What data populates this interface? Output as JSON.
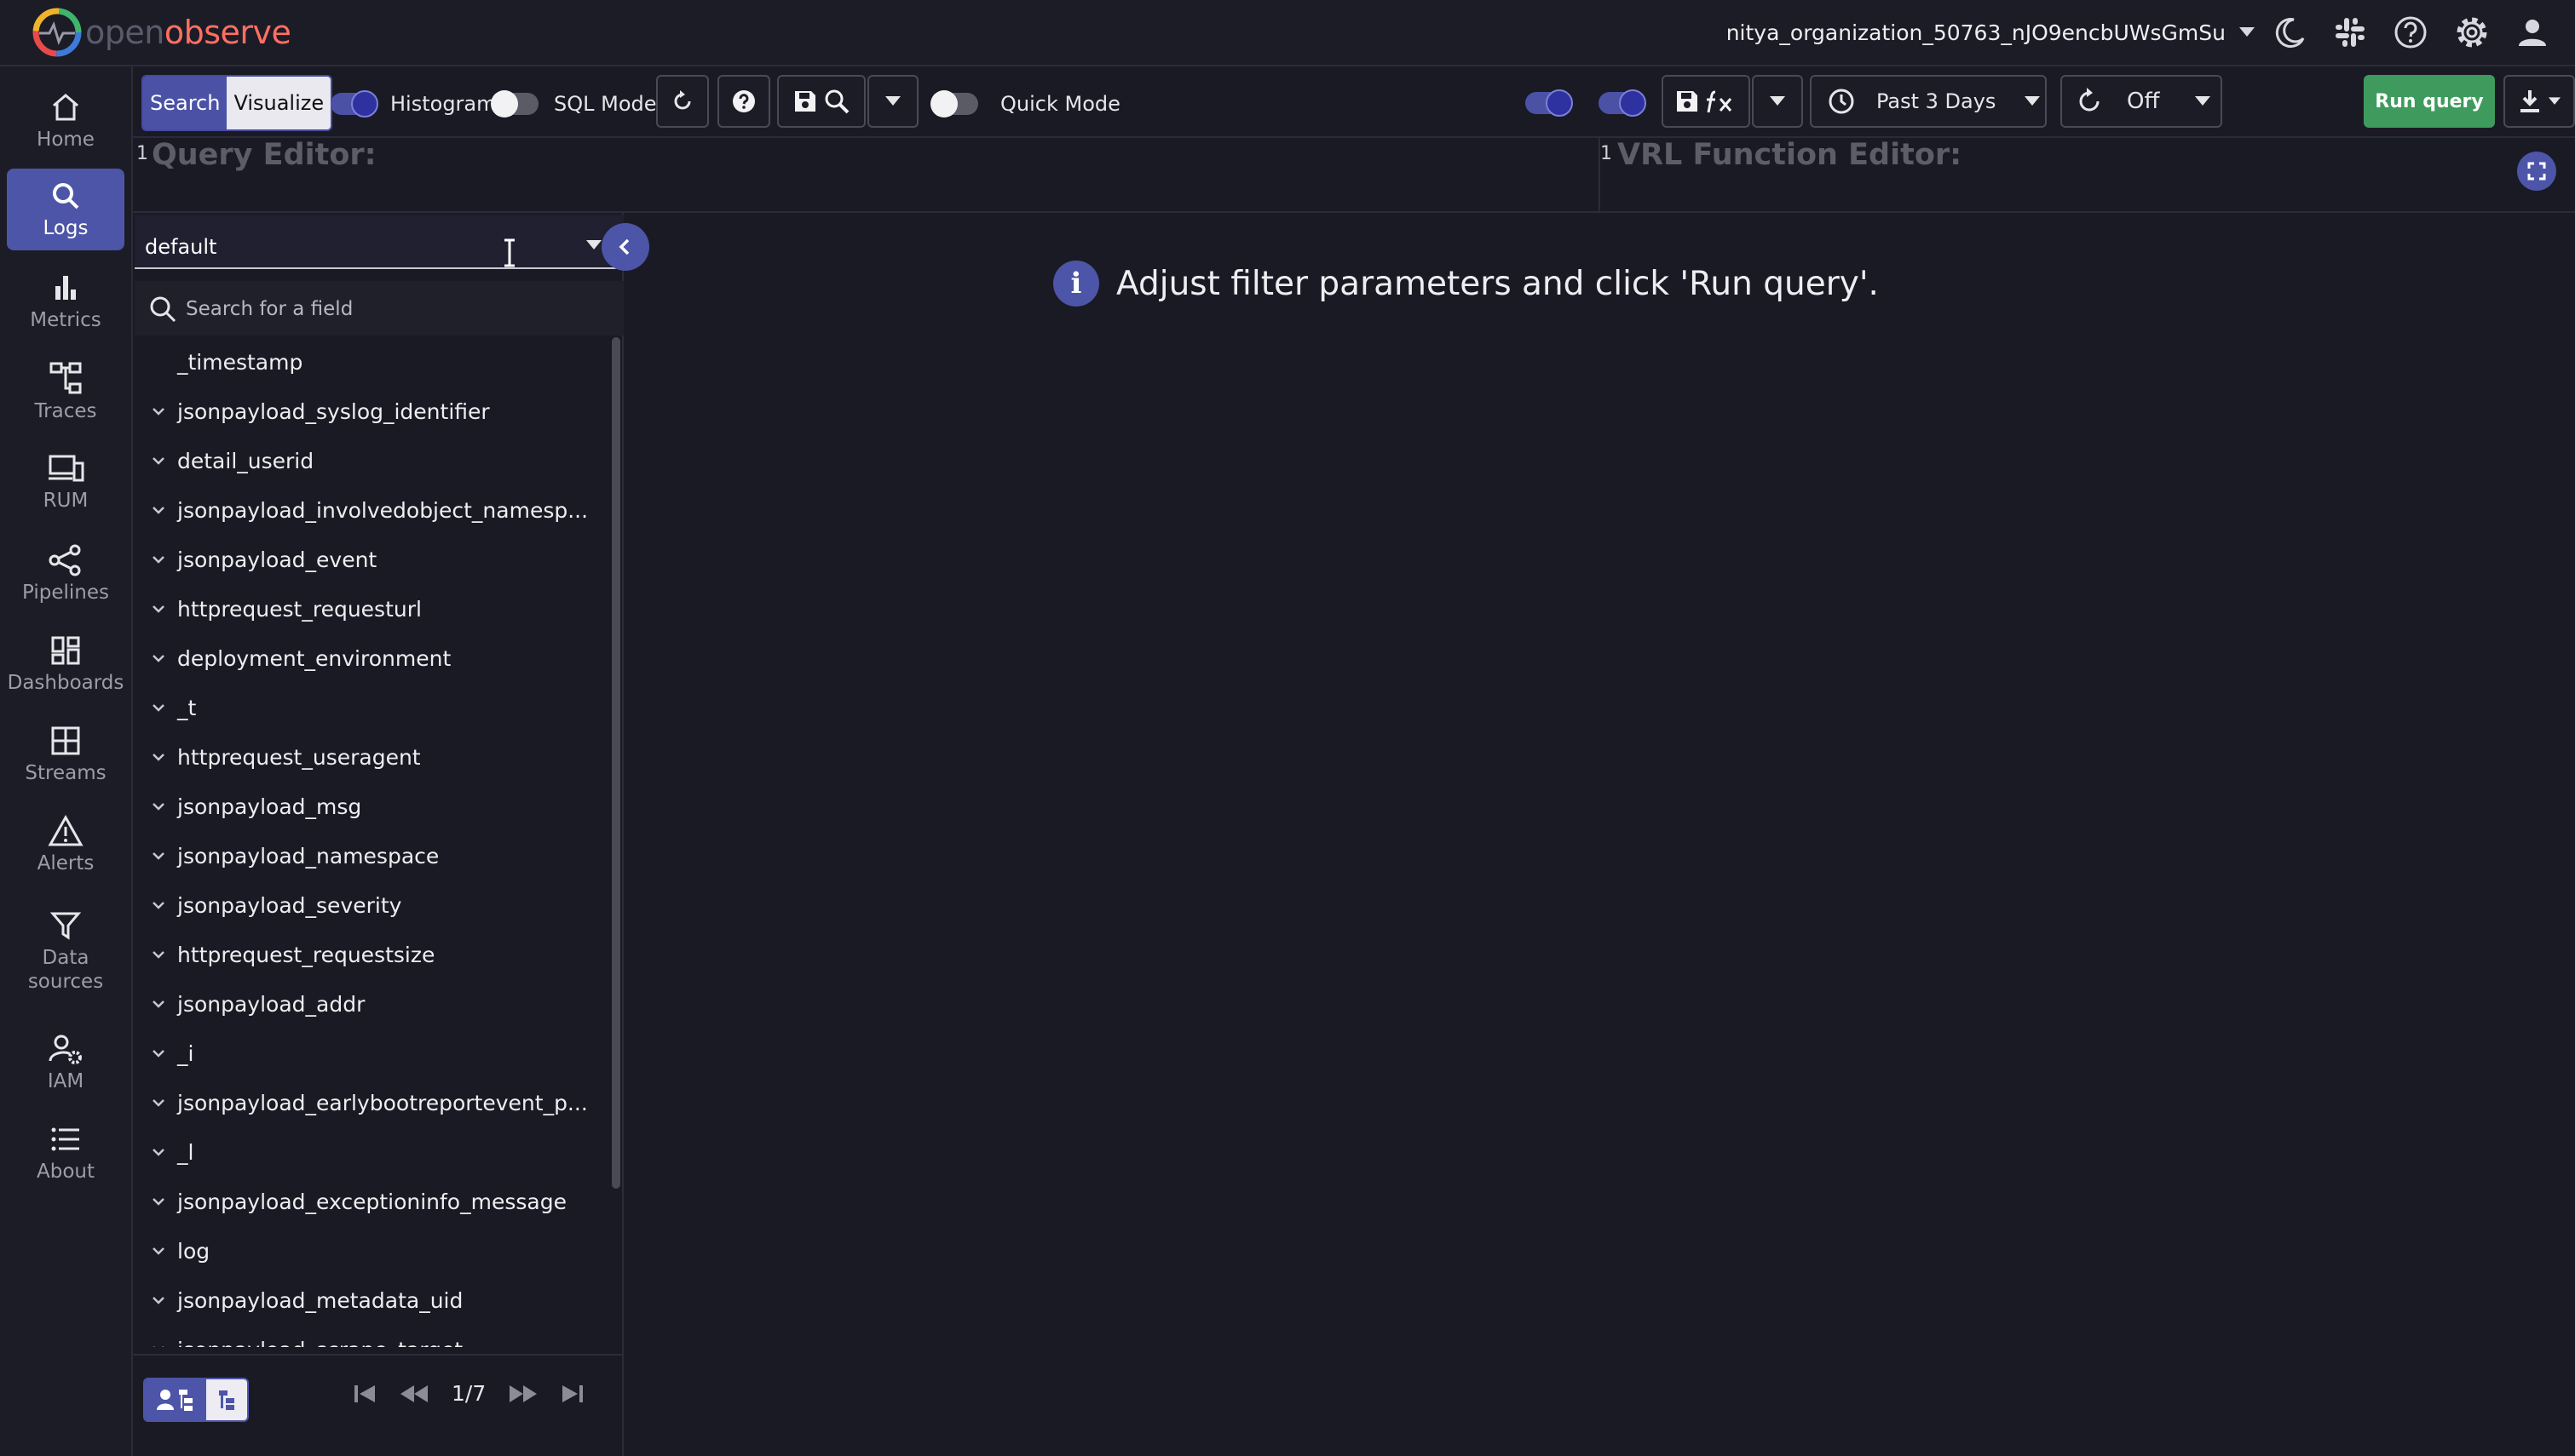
{
  "app": {
    "logo_part1": "open",
    "logo_part2": "observe"
  },
  "header": {
    "organization": "nitya_organization_50763_nJO9encbUWsGmSu"
  },
  "sidebar": {
    "items": [
      {
        "label": "Home",
        "icon": "home-icon"
      },
      {
        "label": "Logs",
        "icon": "search-icon",
        "active": true
      },
      {
        "label": "Metrics",
        "icon": "bar-chart-icon"
      },
      {
        "label": "Traces",
        "icon": "traces-icon"
      },
      {
        "label": "RUM",
        "icon": "devices-icon"
      },
      {
        "label": "Pipelines",
        "icon": "pipeline-icon"
      },
      {
        "label": "Dashboards",
        "icon": "dashboard-icon"
      },
      {
        "label": "Streams",
        "icon": "grid-icon"
      },
      {
        "label": "Alerts",
        "icon": "warning-icon"
      },
      {
        "label": "Data sources",
        "icon": "filter-icon"
      },
      {
        "label": "IAM",
        "icon": "user-gear-icon"
      },
      {
        "label": "About",
        "icon": "list-icon"
      }
    ]
  },
  "toolbar": {
    "search_tab": "Search",
    "visualize_tab": "Visualize",
    "histogram_label": "Histogram",
    "sql_mode_label": "SQL Mode",
    "quick_mode_label": "Quick Mode",
    "time_range": "Past 3 Days",
    "refresh_interval": "Off",
    "run_query": "Run query"
  },
  "editors": {
    "query_line": "1",
    "query_placeholder": "Query Editor:",
    "vrl_line": "1",
    "vrl_placeholder": "VRL Function Editor:"
  },
  "fields_panel": {
    "stream": "default",
    "search_placeholder": "Search for a field",
    "fields": [
      "_timestamp",
      "jsonpayload_syslog_identifier",
      "detail_userid",
      "jsonpayload_involvedobject_namesp...",
      "jsonpayload_event",
      "httprequest_requesturl",
      "deployment_environment",
      "_t",
      "httprequest_useragent",
      "jsonpayload_msg",
      "jsonpayload_namespace",
      "jsonpayload_severity",
      "httprequest_requestsize",
      "jsonpayload_addr",
      "_i",
      "jsonpayload_earlybootreportevent_p...",
      "_l",
      "jsonpayload_exceptioninfo_message",
      "log",
      "jsonpayload_metadata_uid",
      "jsonpayload_scrape_target"
    ],
    "page": "1/7"
  },
  "main": {
    "message": "Adjust filter parameters and click 'Run query'."
  }
}
